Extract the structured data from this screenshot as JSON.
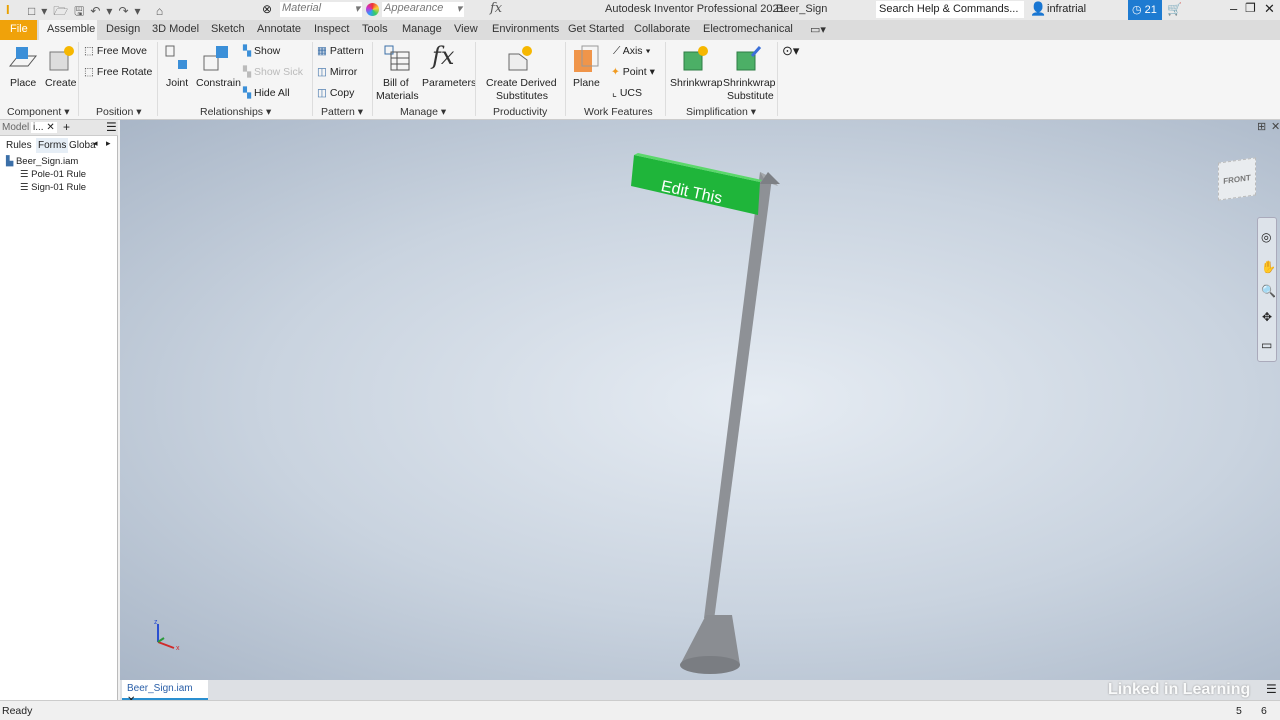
{
  "qat": {
    "material": "Material",
    "appearance": "Appearance",
    "title": "Autodesk Inventor Professional 2021",
    "doc": "Beer_Sign",
    "search": "Search Help & Commands...",
    "user": "infratrial",
    "notifications": "21"
  },
  "tabs": [
    "File",
    "Assemble",
    "Design",
    "3D Model",
    "Sketch",
    "Annotate",
    "Inspect",
    "Tools",
    "Manage",
    "View",
    "Environments",
    "Get Started",
    "Collaborate",
    "Electromechanical"
  ],
  "ribbon": {
    "place": "Place",
    "create": "Create",
    "free_move": "Free Move",
    "free_rotate": "Free Rotate",
    "joint": "Joint",
    "constrain": "Constrain",
    "show": "Show",
    "show_sick": "Show Sick",
    "hide_all": "Hide All",
    "pattern": "Pattern",
    "mirror": "Mirror",
    "copy": "Copy",
    "bom1": "Bill of",
    "bom2": "Materials",
    "parameters": "Parameters",
    "cds1": "Create Derived",
    "cds2": "Substitutes",
    "plane": "Plane",
    "axis": "Axis",
    "point": "Point",
    "ucs": "UCS",
    "shrinkwrap": "Shrinkwrap",
    "sws1": "Shrinkwrap",
    "sws2": "Substitute",
    "groups": [
      "Component",
      "Position",
      "Relationships",
      "Pattern",
      "Manage",
      "Productivity",
      "Work Features",
      "Simplification"
    ]
  },
  "browser": {
    "tab_model": "Model",
    "tab_ilogic": "i...",
    "subtabs": [
      "Rules",
      "Forms",
      "Globa"
    ],
    "tree": [
      {
        "label": "Beer_Sign.iam"
      },
      {
        "label": "Pole-01 Rule"
      },
      {
        "label": "Sign-01 Rule"
      }
    ]
  },
  "viewport": {
    "sign_text": "Edit This",
    "viewcube": "FRONT",
    "sign_color": "#1fb53a",
    "pole_color": "#8a8d92"
  },
  "doc_tab": "Beer_Sign.iam",
  "status": {
    "text": "Ready",
    "n1": "5",
    "n2": "6"
  },
  "watermark": "Linked in Learning"
}
